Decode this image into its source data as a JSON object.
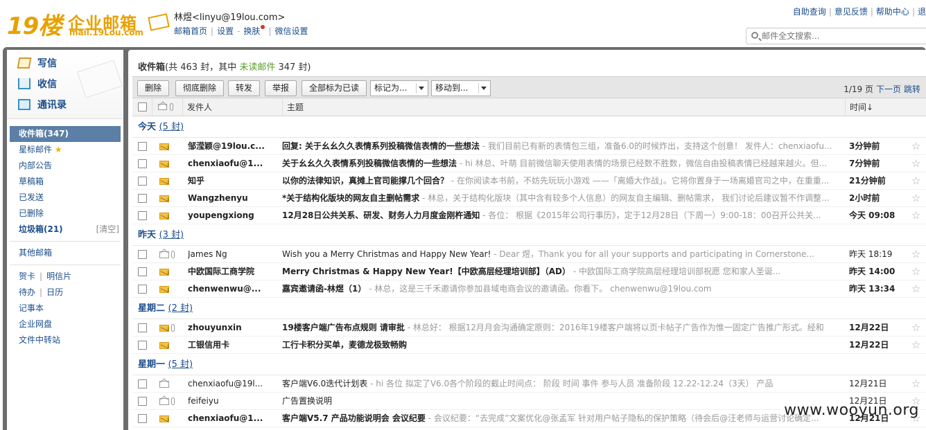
{
  "header": {
    "logo_big": "19楼",
    "logo_cn": "企业邮箱",
    "logo_domain": "mail.19Lou.com",
    "user_name": "林煜",
    "user_email": "<linyu@19lou.com>",
    "nav": [
      "邮箱首页",
      "设置",
      "换肤",
      "微信设置"
    ],
    "right_links": [
      "自助查询",
      "意见反馈",
      "帮助中心",
      "退"
    ],
    "search_placeholder": "邮件全文搜索..."
  },
  "sidebar": {
    "quick": [
      {
        "label": "写信",
        "icon": "pencil-icon"
      },
      {
        "label": "收信",
        "icon": "inbox-download-icon"
      },
      {
        "label": "通讯录",
        "icon": "contacts-icon"
      }
    ],
    "folders": [
      {
        "label": "收件箱(347)",
        "active": true
      },
      {
        "label": "星标邮件"
      },
      {
        "label": "内部公告"
      },
      {
        "label": "草稿箱"
      },
      {
        "label": "已发送"
      },
      {
        "label": "已删除"
      },
      {
        "label": "垃圾箱(21)",
        "clear": "[清空]"
      }
    ],
    "other_mailbox": "其他邮箱",
    "tools": [
      [
        "贺卡",
        "明信片"
      ],
      [
        "待办",
        "日历"
      ],
      [
        "记事本"
      ],
      [
        "企业网盘"
      ],
      [
        "文件中转站"
      ]
    ]
  },
  "main": {
    "title_prefix": "收件箱",
    "title_mid": "(共 463 封，其中 ",
    "unread_link": "未读邮件",
    "title_suffix": " 347 封)",
    "buttons": [
      "删除",
      "彻底删除",
      "转发",
      "举报",
      "全部标为已读"
    ],
    "dropdowns": [
      "标记为...",
      "移动到..."
    ],
    "pager": {
      "page": "1/19 页",
      "next": "下一页",
      "jump": "跳转"
    },
    "columns": {
      "from": "发件人",
      "subject": "主题",
      "time": "时间↓"
    }
  },
  "groups": [
    {
      "label": "今天",
      "count": "(5 封)",
      "rows": [
        {
          "from": "邹滢颖@19lou.c...",
          "subject": "回复: 关于幺幺久久表情系列投稿微信表情的一些想法",
          "preview": " - 我们目前已有新的表情包三组，准备6.0的时候炸出，支持这个创意！ 发件人：chenxiaofu...",
          "time": "3分钟前",
          "unread": true,
          "attach": false
        },
        {
          "from": "chenxiaofu@1...",
          "subject": "关于幺幺久久表情系列投稿微信表情的一些想法",
          "preview": " - hi 林总、叶萌 目前微信聊天使用表情的场景已经数不胜数，微信自由投稿表情已经越来越火。但...",
          "time": "7分钟前",
          "unread": true,
          "attach": false
        },
        {
          "from": "知乎",
          "subject": "以你的法律知识，真摊上官司能撑几个回合？",
          "preview": " - 在你阅读本书前，不妨先玩玩小游戏 ——「离婚大作战」。它将你置身于一场离婚官司之中，在重重...",
          "time": "21分钟前",
          "unread": true,
          "attach": false
        },
        {
          "from": "Wangzhenyu",
          "subject": "*关于结构化版块的网友自主删帖需求",
          "preview": " - 林总，关于结构化版块（其中含有较多个人信息）的网友自主编辑、删帖需求， 我们讨论后建议暂不作调整...",
          "time": "2小时前",
          "unread": true,
          "attach": false
        },
        {
          "from": "youpengxiong",
          "subject": "12月28日公共关系、研发、财务人力月度金刚杵通知",
          "preview": " - 各位： 根据《2015年公司行事历》，定于12月28日（下周一）9:00-18：00召开公共关...",
          "time": "今天 09:08",
          "unread": true,
          "attach": false
        }
      ]
    },
    {
      "label": "昨天",
      "count": "(3 封)",
      "rows": [
        {
          "from": "James Ng",
          "subject": "Wish you a Merry Christmas and Happy New Year!",
          "preview": " - Dear 煜，Thank you for all your supports and participating in Cornerstone...",
          "time": "昨天 18:19",
          "unread": false,
          "attach": true
        },
        {
          "from": "中欧国际工商学院",
          "subject": "Merry Christmas & Happy New Year!【中欧高层经理培训部】（AD）",
          "preview": " -                中欧国际工商学院高层经理培训部祝愿 您和家人圣诞...",
          "time": "昨天 14:00",
          "unread": true,
          "attach": false
        },
        {
          "from": "chenwenwu@...",
          "subject": "嘉宾邀请函-林煜（1）",
          "preview": " - 林总，这是三千禾邀请你参加县域电商会议的邀请函。你看下。 chenwenwu@19lou.com",
          "time": "昨天 13:34",
          "unread": true,
          "attach": false
        }
      ]
    },
    {
      "label": "星期二",
      "count": "(2 封)",
      "rows": [
        {
          "from": "zhouyunxin",
          "subject": "19楼客户端广告布点规则 请审批",
          "preview": " - 林总好： 根据12月月会沟通确定原则：2016年19楼客户端将以页卡帖子广告作为惟一固定广告推广形式。经和",
          "time": "12月22日",
          "unread": true,
          "attach": true
        },
        {
          "from": "工银信用卡",
          "subject": "工行卡积分买单，麦德龙极致畅购",
          "preview": "",
          "time": "12月22日",
          "unread": true,
          "attach": false
        }
      ]
    },
    {
      "label": "星期一",
      "count": "(5 封)",
      "rows": [
        {
          "from": "chenxiaofu@19l...",
          "subject": "客户端V6.0迭代计划表",
          "preview": " - hi 各位 拟定了V6.0各个阶段的截止时间点： 阶段 时间 事件 参与人员 准备阶段 12.22-12.24（3天） 产品",
          "time": "12月21日",
          "unread": false,
          "attach": false
        },
        {
          "from": "feifeiyu",
          "subject": "广告置换说明",
          "preview": "",
          "time": "12月21日",
          "unread": false,
          "attach": true
        },
        {
          "from": "chenxiaofu@1...",
          "subject": "客户端V5.7 产品功能说明会 会议纪要",
          "preview": " - 会议纪要：“去完成”文案优化@张孟军 针对用户帖子隐私的保护策略（待会后@汪老师与运营讨论确定...",
          "time": "12月21日",
          "unread": true,
          "attach": false
        }
      ]
    }
  ],
  "watermark": "www.wooyun.org",
  "colors": {
    "accent": "#e8a100",
    "link": "#1a4d8c",
    "active_folder": "#5b7fa6",
    "frame": "#6d6d6d",
    "unread_link": "#5a9e2a"
  }
}
